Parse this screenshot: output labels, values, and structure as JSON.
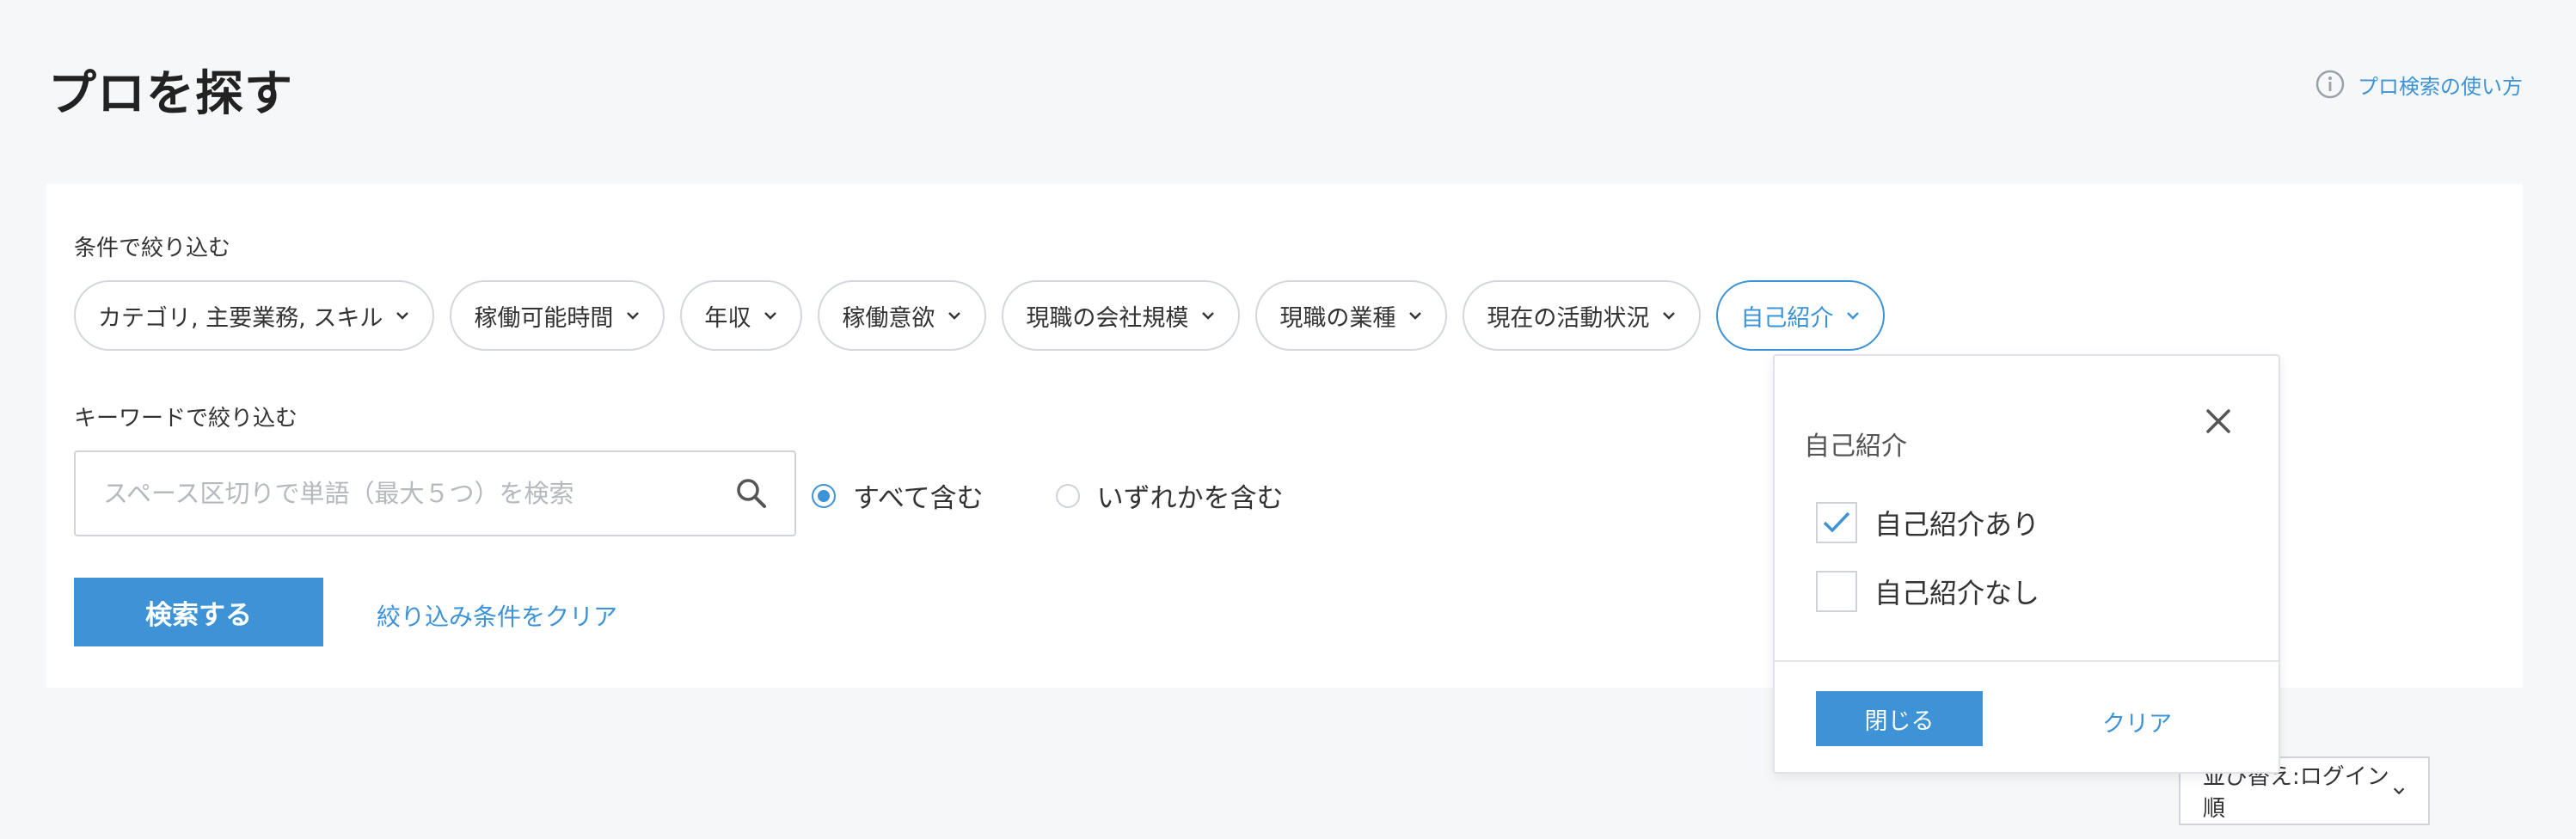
{
  "header": {
    "title": "プロを探す",
    "help_link": "プロ検索の使い方",
    "help_icon": "info-circle-icon"
  },
  "filters": {
    "label": "条件で絞り込む",
    "chips": [
      {
        "label": "カテゴリ, 主要業務, スキル",
        "active": false
      },
      {
        "label": "稼働可能時間",
        "active": false
      },
      {
        "label": "年収",
        "active": false
      },
      {
        "label": "稼働意欲",
        "active": false
      },
      {
        "label": "現職の会社規模",
        "active": false
      },
      {
        "label": "現職の業種",
        "active": false
      },
      {
        "label": "現在の活動状況",
        "active": false
      },
      {
        "label": "自己紹介",
        "active": true
      }
    ]
  },
  "keyword": {
    "label": "キーワードで絞り込む",
    "placeholder": "スペース区切りで単語（最大５つ）を検索",
    "value": "",
    "match_options": [
      {
        "label": "すべて含む",
        "selected": true
      },
      {
        "label": "いずれかを含む",
        "selected": false
      }
    ]
  },
  "actions": {
    "search_label": "検索する",
    "clear_label": "絞り込み条件をクリア"
  },
  "sort": {
    "selected": "並び替え:ログイン順"
  },
  "popover": {
    "title": "自己紹介",
    "options": [
      {
        "label": "自己紹介あり",
        "checked": true
      },
      {
        "label": "自己紹介なし",
        "checked": false
      }
    ],
    "close_label": "閉じる",
    "clear_label": "クリア"
  },
  "colors": {
    "accent": "#3d93d6",
    "background": "#f6f7f9",
    "border": "#d3d7dc"
  }
}
